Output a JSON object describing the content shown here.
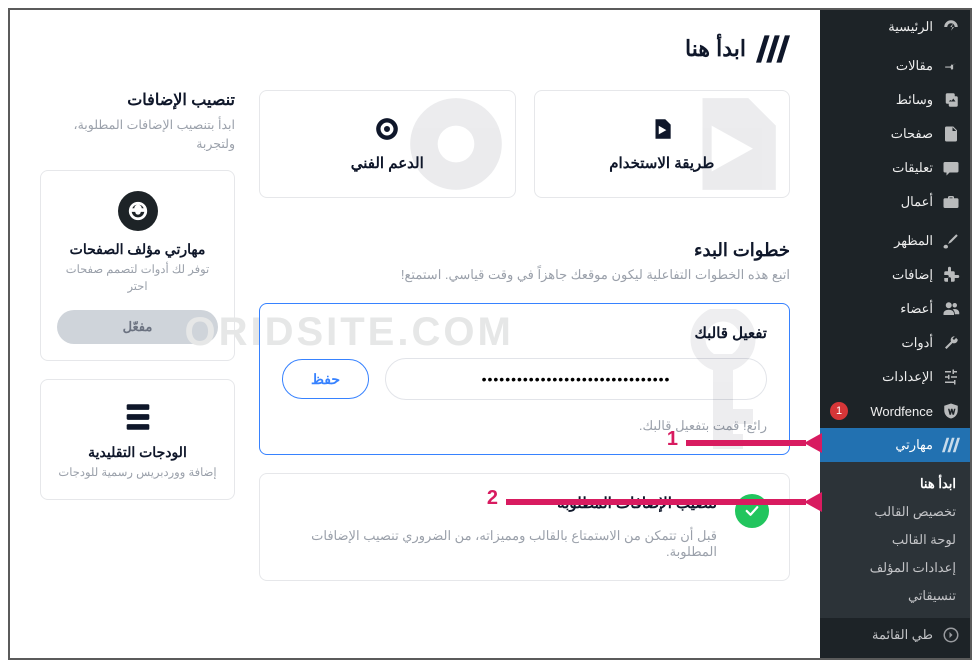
{
  "menu": {
    "items": [
      {
        "icon": "dashboard",
        "label": "الرئيسية"
      },
      {
        "sep": true
      },
      {
        "icon": "pin",
        "label": "مقالات"
      },
      {
        "icon": "media",
        "label": "وسائط"
      },
      {
        "icon": "page",
        "label": "صفحات"
      },
      {
        "icon": "comment",
        "label": "تعليقات"
      },
      {
        "icon": "briefcase",
        "label": "أعمال"
      },
      {
        "sep": true
      },
      {
        "icon": "brush",
        "label": "المظهر"
      },
      {
        "icon": "plugin",
        "label": "إضافات"
      },
      {
        "icon": "users",
        "label": "أعضاء"
      },
      {
        "icon": "wrench",
        "label": "أدوات"
      },
      {
        "icon": "sliders",
        "label": "الإعدادات"
      },
      {
        "icon": "wordfence",
        "label": "Wordfence",
        "badge": "1",
        "badgeClass": "badge-wordfence"
      },
      {
        "icon": "maharti",
        "label": "مهارتي",
        "current": true
      }
    ],
    "submenu": [
      {
        "label": "ابدأ هنا",
        "active": true
      },
      {
        "label": "تخصيص القالب"
      },
      {
        "label": "لوحة القالب"
      },
      {
        "label": "إعدادات المؤلف"
      },
      {
        "label": "تنسيقاتي"
      }
    ],
    "collapse": "طي القائمة"
  },
  "page": {
    "title": "ابدأ هنا",
    "info_cards": [
      {
        "label": "طريقة الاستخدام",
        "icon": "play",
        "bg": "play-bg"
      },
      {
        "label": "الدعم الفني",
        "icon": "lifebuoy",
        "bg": "lifebuoy-bg"
      }
    ],
    "steps_head": "خطوات البدء",
    "steps_sub": "اتبع هذه الخطوات التفاعلية ليكون موقعك جاهزاً في وقت قياسي. استمتع!",
    "step1": {
      "title": "تفعيل قالبك",
      "value": "••••••••••••••••••••••••••••••••",
      "save": "حفظ",
      "done_msg": "رائع! قمت بتفعيل قالبك."
    },
    "step2": {
      "title": "تنصيب الإضافات المطلوبة",
      "desc": "قبل أن تتمكن من الاستمتاع بالقالب ومميزاته، من الضروري تنصيب الإضافات المطلوبة."
    },
    "side": {
      "title": "تنصيب الإضافات",
      "sub": "ابدأ بتنصيب الإضافات المطلوبة، ولتجربة",
      "plugin": {
        "title": "مهارتي مؤلف الصفحات",
        "desc": "توفر لك أدوات لتصمم صفحات احتر",
        "btn": "مفعّل"
      },
      "widget": {
        "title": "الودجات التقليدية",
        "desc": "إضافة ووردبريس رسمية للودجات"
      }
    },
    "watermark": "ORIDSITE.COM",
    "annotations": {
      "n1": "1",
      "n2": "2"
    }
  }
}
